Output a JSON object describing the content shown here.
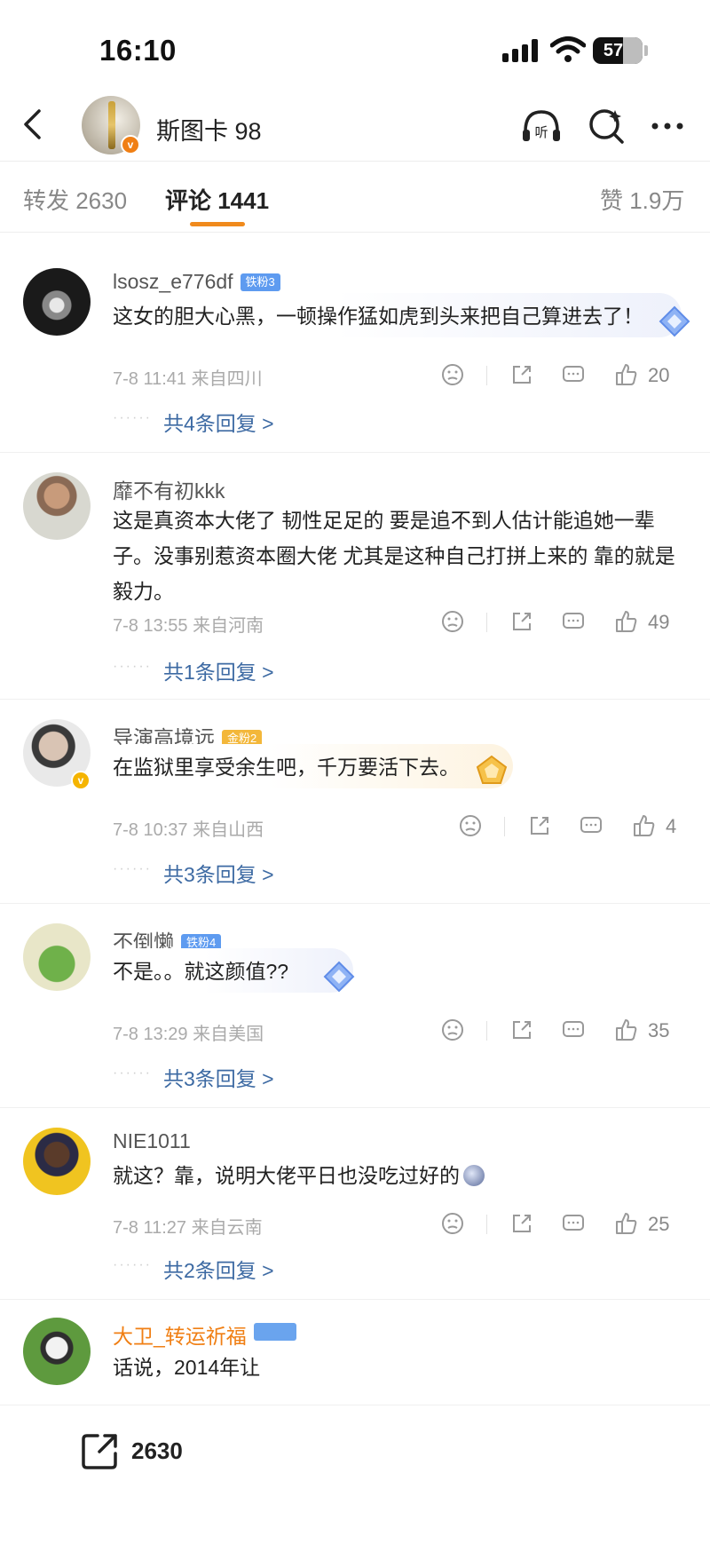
{
  "status": {
    "time": "16:10",
    "battery": "57"
  },
  "header": {
    "title": "斯图卡 98"
  },
  "tabs": [
    {
      "label": "转发 2630"
    },
    {
      "label": "评论 1441"
    },
    {
      "label": "赞 1.9万"
    }
  ],
  "comments": [
    {
      "user": "lsosz_e776df",
      "badge": "铁粉3",
      "text": "这女的胆大心黑，一顿操作猛如虎到头来把自己算进去了！",
      "time": "7-8 11:41",
      "location": "来自四川",
      "likes": "20",
      "replies": "共4条回复 >"
    },
    {
      "user": "靡不有初kkk",
      "badge": "",
      "text": "这是真资本大佬了 韧性足足的 要是追不到人估计能追她一辈子。没事别惹资本圈大佬 尤其是这种自己打拼上来的 靠的就是毅力。",
      "time": "7-8 13:55",
      "location": "来自河南",
      "likes": "49",
      "replies": "共1条回复 >"
    },
    {
      "user": "导演高境远",
      "badge": "金粉2",
      "text": "在监狱里享受余生吧，千万要活下去。",
      "time": "7-8 10:37",
      "location": "来自山西",
      "likes": "4",
      "replies": "共3条回复 >"
    },
    {
      "user": "不倒懒",
      "badge": "铁粉4",
      "text": "不是。。就这颜值??",
      "time": "7-8 13:29",
      "location": "来自美国",
      "likes": "35",
      "replies": "共3条回复 >"
    },
    {
      "user": "NIE1011",
      "badge": "",
      "text": "就这？靠，说明大佬平日也没吃过好的",
      "time": "7-8 11:27",
      "location": "来自云南",
      "likes": "25",
      "replies": "共2条回复 >"
    },
    {
      "user": "大卫_转运祈福",
      "badge": "",
      "text": "话说，2014年让",
      "time": "",
      "location": "",
      "likes": "",
      "replies": ""
    }
  ],
  "bottom": {
    "share_count": "2630"
  },
  "colors": {
    "accent": "#f08a1c",
    "reply_link": "#3d6aa3",
    "iron_badge": "#5e9bf0",
    "gold_badge": "#f3b73a"
  },
  "icons": [
    "back-icon",
    "listen-icon",
    "search-icon",
    "more-icon",
    "dislike-icon",
    "share-icon",
    "comment-icon",
    "like-icon",
    "repost-icon"
  ]
}
